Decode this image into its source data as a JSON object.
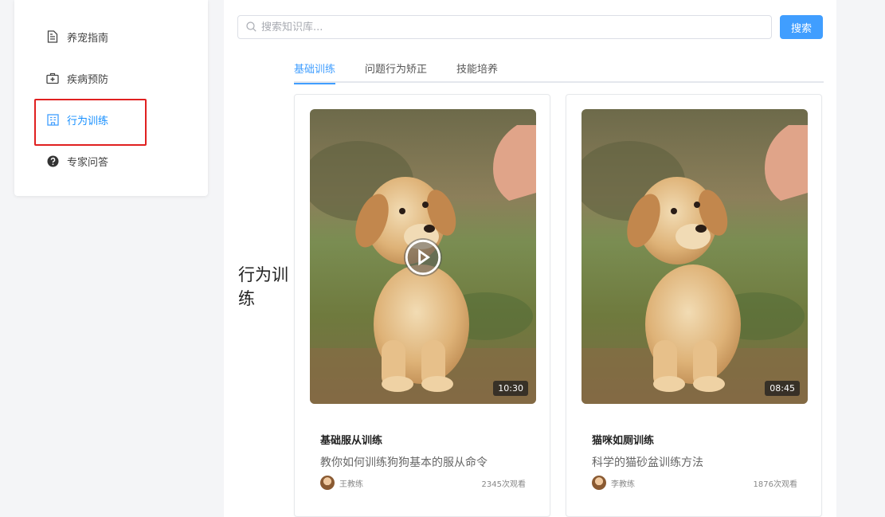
{
  "sidebar": {
    "items": [
      {
        "label": "养宠指南",
        "icon": "document-icon",
        "active": false
      },
      {
        "label": "疾病预防",
        "icon": "medical-kit-icon",
        "active": false
      },
      {
        "label": "行为训练",
        "icon": "building-icon",
        "active": true
      },
      {
        "label": "专家问答",
        "icon": "question-circle-icon",
        "active": false
      }
    ]
  },
  "search": {
    "placeholder": "搜索知识库...",
    "value": "",
    "button_label": "搜索"
  },
  "tabs": [
    {
      "label": "基础训练",
      "active": true
    },
    {
      "label": "问题行为矫正",
      "active": false
    },
    {
      "label": "技能培养",
      "active": false
    }
  ],
  "section": {
    "title": "行为训练"
  },
  "videos": [
    {
      "title": "基础服从训练",
      "description": "教你如何训练狗狗基本的服从命令",
      "author": "王教练",
      "views": "2345次观看",
      "duration": "10:30"
    },
    {
      "title": "猫咪如厕训练",
      "description": "科学的猫砂盆训练方法",
      "author": "李教练",
      "views": "1876次观看",
      "duration": "08:45"
    }
  ],
  "colors": {
    "accent": "#409eff",
    "highlight_border": "#e02020"
  }
}
